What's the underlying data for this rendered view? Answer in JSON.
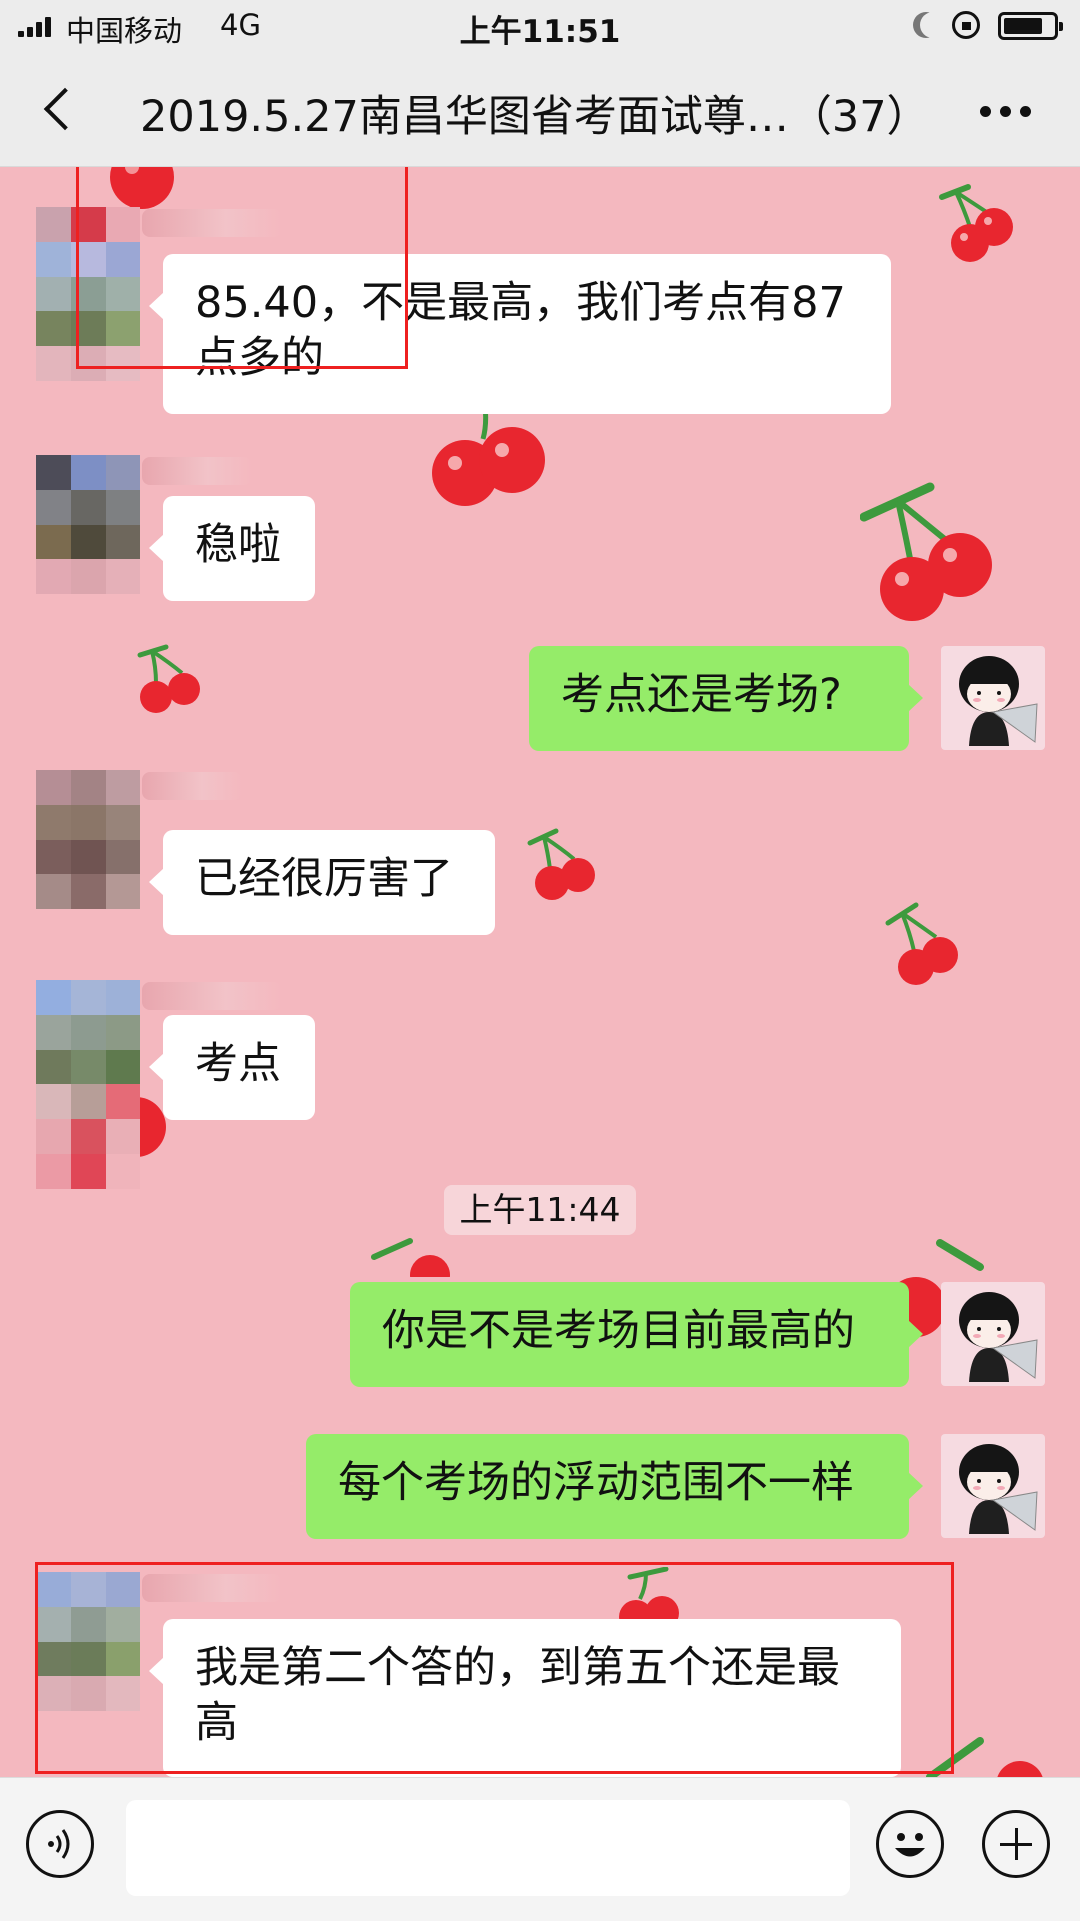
{
  "status_bar": {
    "carrier": "中国移动",
    "network": "4G",
    "time": "上午11:51",
    "icons": [
      "signal-icon",
      "moon-icon",
      "rotation-lock-icon",
      "battery-icon"
    ]
  },
  "nav": {
    "back_icon": "chevron-left-icon",
    "title": "2019.5.27南昌华图省考面试尊…（37）",
    "more_icon": "more-icon"
  },
  "messages": [
    {
      "side": "in",
      "text": "85.40，不是最高，我们考点有87点多的"
    },
    {
      "side": "in",
      "text": "稳啦"
    },
    {
      "side": "out",
      "text": "考点还是考场?"
    },
    {
      "side": "in",
      "text": "已经很厉害了"
    },
    {
      "side": "in",
      "text": "考点"
    },
    {
      "side": "out",
      "text": "你是不是考场目前最高的"
    },
    {
      "side": "out",
      "text": "每个考场的浮动范围不一样"
    },
    {
      "side": "in",
      "text": "我是第二个答的，到第五个还是最高"
    }
  ],
  "timestamp": "上午11:44",
  "input_bar": {
    "voice_icon": "voice-icon",
    "placeholder": "",
    "emoji_icon": "emoji-icon",
    "plus_icon": "plus-icon"
  },
  "colors": {
    "chat_background": "#f4b8bf",
    "incoming_bubble": "#ffffff",
    "outgoing_bubble": "#95ec69",
    "highlight_box": "#ee2020",
    "bars": "#ececec"
  }
}
